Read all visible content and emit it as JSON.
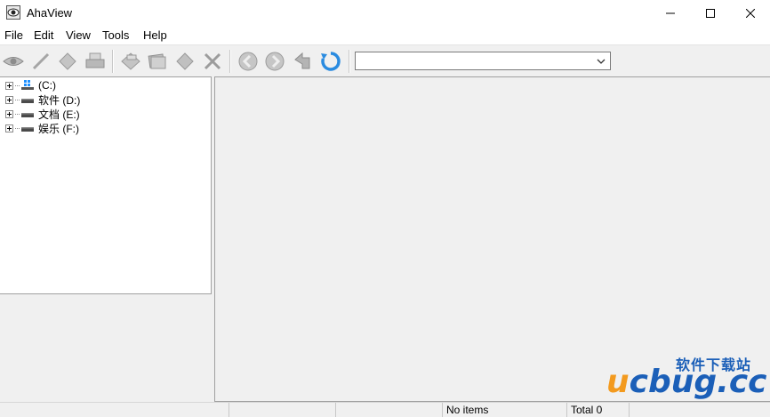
{
  "window": {
    "title": "AhaView",
    "icon": "eye-icon"
  },
  "menu": [
    "File",
    "Edit",
    "View",
    "Tools",
    "Help"
  ],
  "toolbar": {
    "buttons": [
      "view-eye-icon",
      "edit-pencil-icon",
      "tag-icon",
      "print-icon",
      "jpeg-icon",
      "slideshow-icon",
      "label-icon",
      "delete-icon",
      "back-icon",
      "forward-icon",
      "up-icon",
      "refresh-icon"
    ],
    "path_value": ""
  },
  "tree": [
    {
      "label": "(C:)",
      "icon": "system-drive-icon"
    },
    {
      "label": "软件 (D:)",
      "icon": "drive-icon"
    },
    {
      "label": "文档 (E:)",
      "icon": "drive-icon"
    },
    {
      "label": "娱乐 (F:)",
      "icon": "drive-icon"
    }
  ],
  "status": {
    "items": "No items",
    "total": "Total 0"
  },
  "watermark": {
    "cn": "软件下载站",
    "en_prefix": "u",
    "en_main": "cbug.cc"
  },
  "colors": {
    "accent": "#1b5fb8",
    "watermark_orange": "#f39a1e",
    "panel": "#f0f0f0"
  }
}
